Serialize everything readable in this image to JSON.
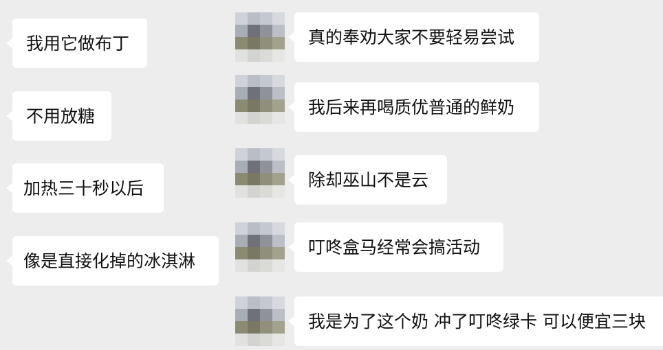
{
  "left_messages": [
    {
      "text": "我用它做布丁"
    },
    {
      "text": "不用放糖"
    },
    {
      "text": "加热三十秒以后"
    },
    {
      "text": "像是直接化掉的冰淇淋"
    }
  ],
  "right_messages": [
    {
      "text": "真的奉劝大家不要轻易尝试"
    },
    {
      "text": "我后来再喝质优普通的鲜奶"
    },
    {
      "text": "除却巫山不是云"
    },
    {
      "text": "叮咚盒马经常会搞活动"
    },
    {
      "text": "我是为了这个奶 冲了叮咚绿卡 可以便宜三块"
    }
  ],
  "colors": {
    "background": "#ededed",
    "bubble": "#ffffff",
    "text": "#111111"
  },
  "avatar_icon": "pixelated-avatar-icon"
}
